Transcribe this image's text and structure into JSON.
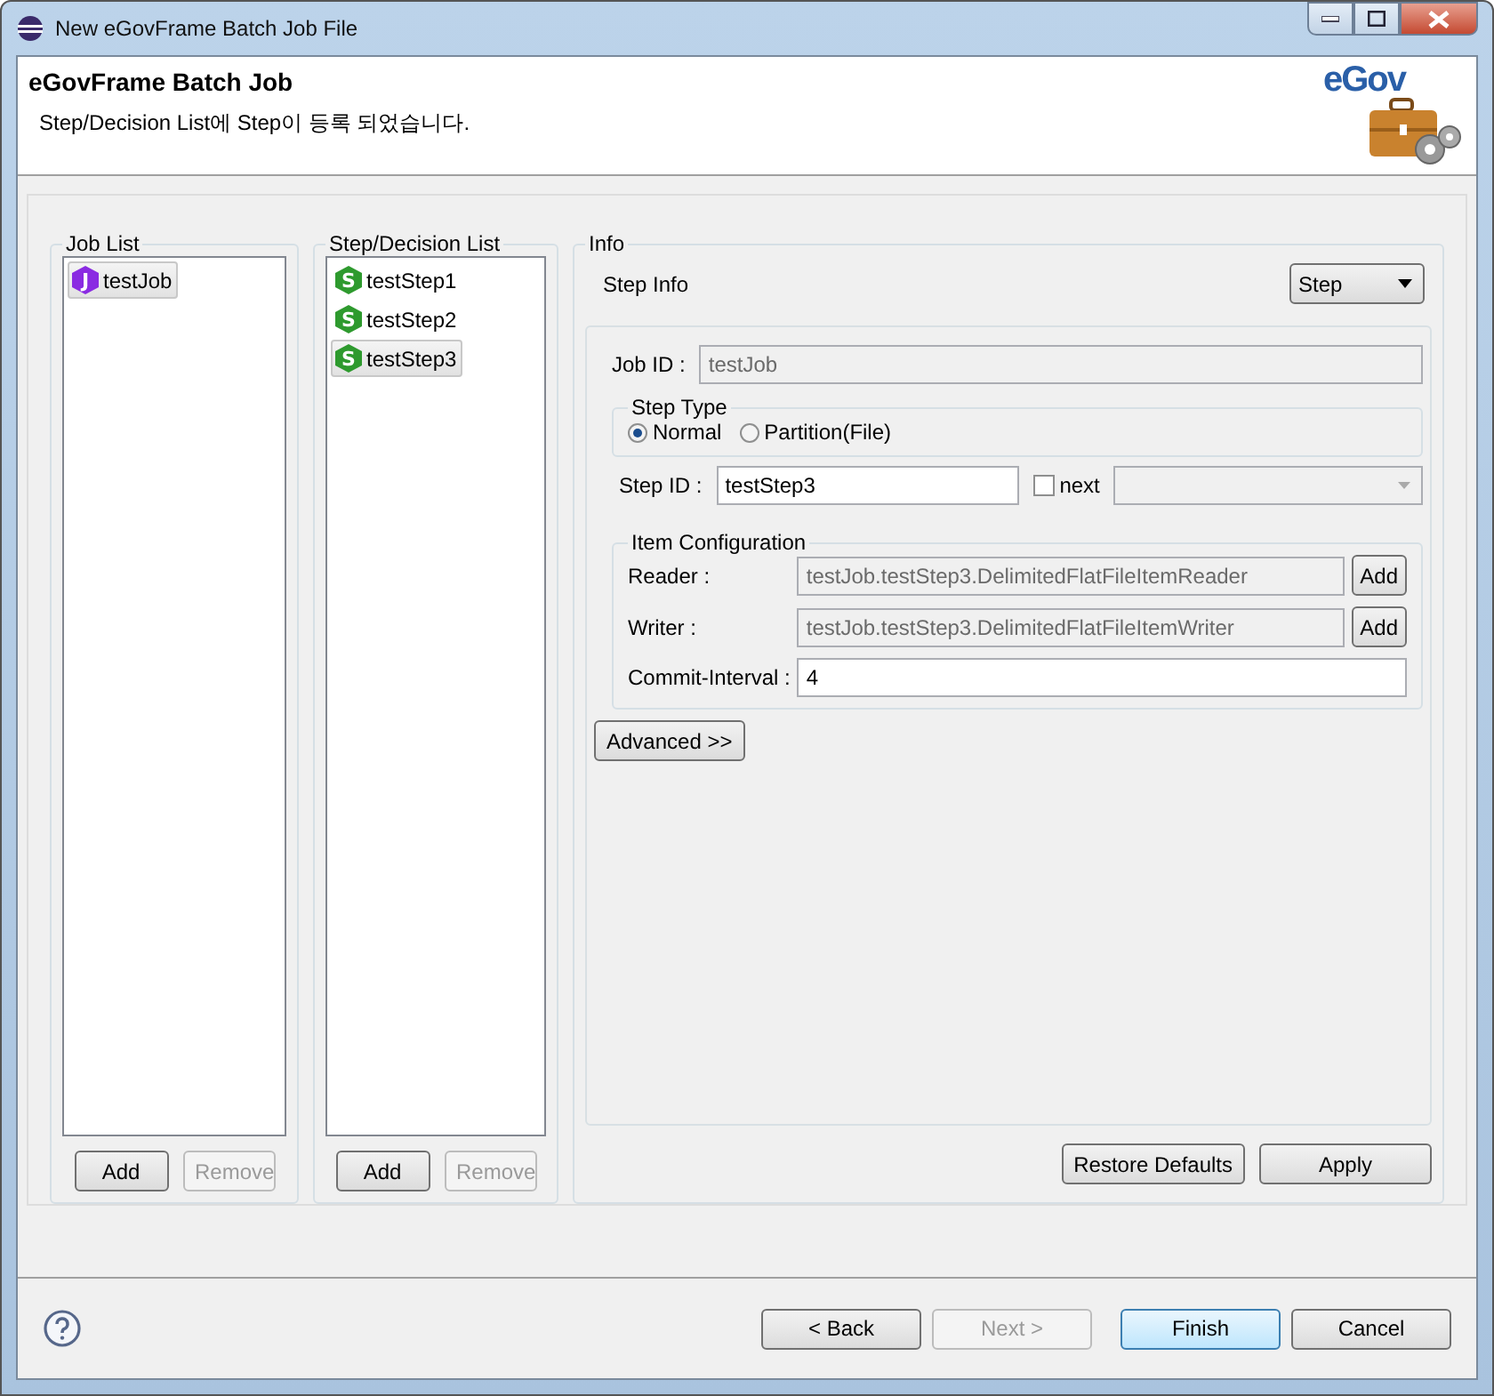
{
  "window": {
    "title": "New eGovFrame Batch Job File"
  },
  "header": {
    "title": "eGovFrame Batch Job",
    "message": "Step/Decision List에 Step이 등록 되었습니다.",
    "logo_text": "eGov"
  },
  "job_list": {
    "label": "Job List",
    "items": [
      {
        "icon_letter": "J",
        "color": "#8a2be2",
        "label": "testJob",
        "selected": true
      }
    ],
    "buttons": [
      {
        "label": "Add",
        "disabled": false
      },
      {
        "label": "Remove",
        "disabled": true
      }
    ]
  },
  "step_list": {
    "label": "Step/Decision List",
    "items": [
      {
        "icon_letter": "S",
        "color": "#2e9a2e",
        "label": "testStep1",
        "selected": false
      },
      {
        "icon_letter": "S",
        "color": "#2e9a2e",
        "label": "testStep2",
        "selected": false
      },
      {
        "icon_letter": "S",
        "color": "#2e9a2e",
        "label": "testStep3",
        "selected": true
      }
    ],
    "buttons": [
      {
        "label": "Add",
        "disabled": false
      },
      {
        "label": "Remove",
        "disabled": true
      }
    ]
  },
  "info": {
    "label": "Info",
    "section": "Step Info",
    "type_dropdown": "Step",
    "job_id": {
      "label": "Job ID :",
      "value": "testJob",
      "disabled": true
    },
    "step_type": {
      "label": "Step Type",
      "options": [
        {
          "label": "Normal",
          "selected": true
        },
        {
          "label": "Partition(File)",
          "selected": false
        }
      ]
    },
    "step_id": {
      "label": "Step ID :",
      "value": "testStep3"
    },
    "next": {
      "label": "next",
      "checked": false
    },
    "item_config": {
      "label": "Item Configuration",
      "rows": [
        {
          "label": "Reader :",
          "value": "testJob.testStep3.DelimitedFlatFileItemReader",
          "button": "Add"
        },
        {
          "label": "Writer :",
          "value": "testJob.testStep3.DelimitedFlatFileItemWriter",
          "button": "Add"
        }
      ],
      "commit": {
        "label": "Commit-Interval :",
        "value": "4"
      }
    },
    "advanced_button": "Advanced >>",
    "restore_button": "Restore Defaults",
    "apply_button": "Apply"
  },
  "nav_buttons": [
    {
      "label": "< Back",
      "disabled": false,
      "default": false
    },
    {
      "label": "Next >",
      "disabled": true,
      "default": false
    },
    {
      "label": "Finish",
      "disabled": false,
      "default": true
    },
    {
      "label": "Cancel",
      "disabled": false,
      "default": false
    }
  ]
}
